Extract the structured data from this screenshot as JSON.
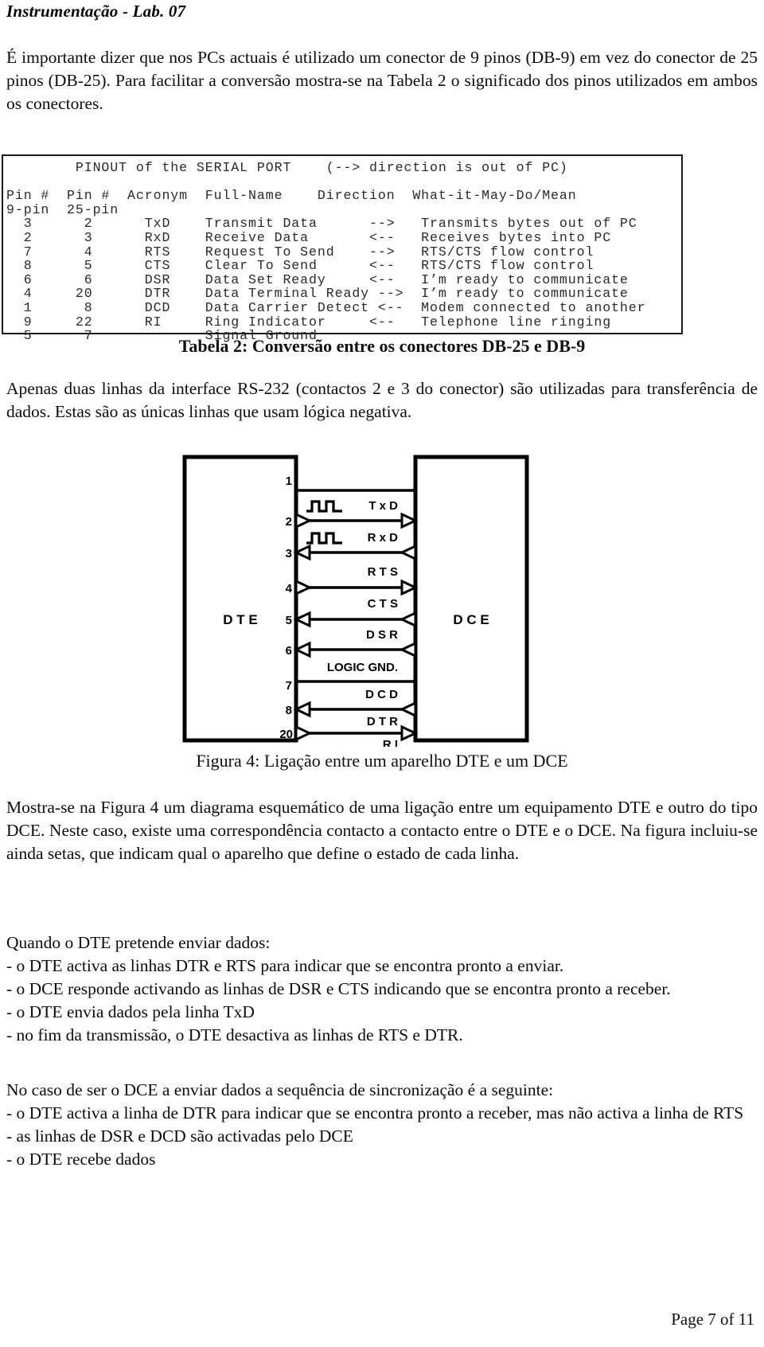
{
  "running_head": "Instrumentação - Lab. 07",
  "paragraphs": {
    "intro": "É importante dizer que nos PCs actuais é utilizado um conector de 9 pinos (DB-9) em vez do conector de 25 pinos (DB-25). Para facilitar a conversão mostra-se na Tabela 2 o significado dos pinos utilizados em ambos os conectores.",
    "after_table": "Apenas duas linhas da interface RS-232 (contactos 2 e 3 do conector) são utilizadas para transferência de dados. Estas são as únicas linhas que usam lógica negativa.",
    "after_figure": "Mostra-se na Figura 4 um diagrama esquemático de uma ligação entre um equipamento DTE e outro do tipo DCE. Neste caso, existe uma correspondência contacto a contacto entre o DTE e o DCE. Na figura incluiu-se ainda setas, que indicam qual o aparelho que define o estado de cada linha."
  },
  "sequences": {
    "dte_heading": "Quando o DTE pretende enviar dados:",
    "dte_items": [
      "- o DTE activa as linhas DTR e RTS para indicar que se encontra pronto a enviar.",
      "- o DCE responde activando as linhas de DSR e CTS indicando que se encontra pronto a receber.",
      "- o DTE envia dados pela linha TxD",
      "- no fim da transmissão, o DTE desactiva as linhas de RTS e DTR."
    ],
    "dce_heading": "No caso de ser o DCE a enviar dados a sequência de sincronização é a seguinte:",
    "dce_items": [
      "- o DTE activa a linha de DTR para indicar que se encontra pronto a receber, mas não activa a linha de RTS",
      "- as linhas de DSR e DCD são activadas pelo DCE",
      "- o DTE recebe dados"
    ]
  },
  "pinout": {
    "title_line": "PINOUT of the SERIAL PORT",
    "title_note": "(--> direction is out of PC)",
    "header_row1": [
      "Pin #",
      "Pin #",
      "Acronym",
      "Full-Name",
      "Direction",
      "What-it-May-Do/Mean"
    ],
    "header_row2": [
      "9-pin",
      "25-pin"
    ],
    "rows": [
      {
        "pin9": "3",
        "pin25": "2",
        "acronym": "TxD",
        "full_name": "Transmit Data",
        "direction": "-->",
        "meaning": "Transmits bytes out of PC"
      },
      {
        "pin9": "2",
        "pin25": "3",
        "acronym": "RxD",
        "full_name": "Receive Data",
        "direction": "<--",
        "meaning": "Receives bytes into PC"
      },
      {
        "pin9": "7",
        "pin25": "4",
        "acronym": "RTS",
        "full_name": "Request To Send",
        "direction": "-->",
        "meaning": "RTS/CTS flow control"
      },
      {
        "pin9": "8",
        "pin25": "5",
        "acronym": "CTS",
        "full_name": "Clear To Send",
        "direction": "<--",
        "meaning": "RTS/CTS flow control"
      },
      {
        "pin9": "6",
        "pin25": "6",
        "acronym": "DSR",
        "full_name": "Data Set Ready",
        "direction": "<--",
        "meaning": "I’m ready to communicate"
      },
      {
        "pin9": "4",
        "pin25": "20",
        "acronym": "DTR",
        "full_name": "Data Terminal Ready",
        "direction": "-->",
        "meaning": "I’m ready to communicate"
      },
      {
        "pin9": "1",
        "pin25": "8",
        "acronym": "DCD",
        "full_name": "Data Carrier Detect",
        "direction": "<--",
        "meaning": "Modem connected to another"
      },
      {
        "pin9": "9",
        "pin25": "22",
        "acronym": "RI",
        "full_name": "Ring Indicator",
        "direction": "<--",
        "meaning": "Telephone line ringing"
      },
      {
        "pin9": "5",
        "pin25": "7",
        "acronym": "",
        "full_name": "Signal Ground",
        "direction": "",
        "meaning": ""
      }
    ],
    "text_block": "        PINOUT of the SERIAL PORT    (--> direction is out of PC)\n\nPin #  Pin #  Acronym  Full-Name    Direction  What-it-May-Do/Mean\n9-pin  25-pin\n  3      2      TxD    Transmit Data      -->   Transmits bytes out of PC\n  2      3      RxD    Receive Data       <--   Receives bytes into PC\n  7      4      RTS    Request To Send    -->   RTS/CTS flow control\n  8      5      CTS    Clear To Send      <--   RTS/CTS flow control\n  6      6      DSR    Data Set Ready     <--   I’m ready to communicate\n  4     20      DTR    Data Terminal Ready -->  I’m ready to communicate\n  1      8      DCD    Data Carrier Detect <--  Modem connected to another\n  9     22      RI     Ring Indicator     <--   Telephone line ringing\n  5      7             Signal Ground"
  },
  "table_caption": "Tabela 2:  Conversão entre os conectores DB-25 e DB-9",
  "figure_caption": "Figura 4:  Ligação entre um aparelho DTE e um DCE",
  "figure": {
    "left_label": "D T E",
    "right_label": "D C E",
    "lines": [
      {
        "pin": "1",
        "label": "",
        "dir": "none",
        "waveform": false
      },
      {
        "pin": "2",
        "label": "T x D",
        "dir": "right",
        "waveform": true
      },
      {
        "pin": "3",
        "label": "R x D",
        "dir": "left",
        "waveform": true
      },
      {
        "pin": "4",
        "label": "R T S",
        "dir": "right",
        "waveform": false
      },
      {
        "pin": "5",
        "label": "C T S",
        "dir": "left",
        "waveform": false
      },
      {
        "pin": "6",
        "label": "D S R",
        "dir": "left",
        "waveform": false
      },
      {
        "pin": "7",
        "label": "LOGIC GND.",
        "dir": "none",
        "waveform": false
      },
      {
        "pin": "8",
        "label": "D C D",
        "dir": "left",
        "waveform": false
      },
      {
        "pin": "20",
        "label": "D T R",
        "dir": "right",
        "waveform": false
      },
      {
        "pin": "",
        "label": "R I",
        "dir": "left",
        "waveform": false
      }
    ]
  },
  "page_footer": "Page 7 of 11",
  "colors": {
    "ink": "#000000",
    "paper": "#ffffff",
    "mono_ink": "#2a2a2a"
  }
}
